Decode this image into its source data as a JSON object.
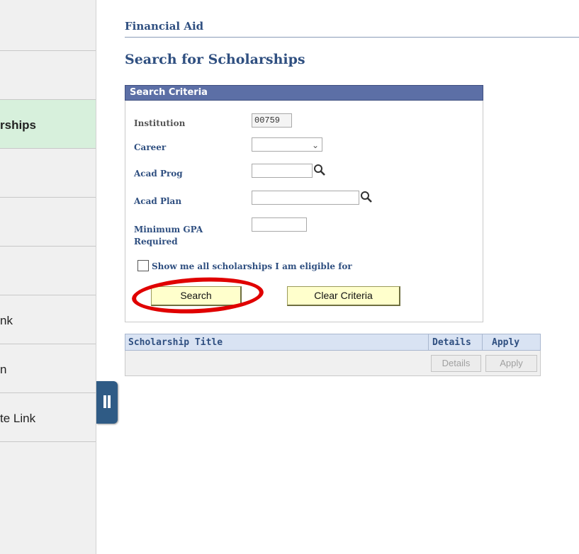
{
  "sidebar": {
    "items": [
      {
        "label": ""
      },
      {
        "label": ""
      },
      {
        "label": "rships"
      },
      {
        "label": ""
      },
      {
        "label": ""
      },
      {
        "label": ""
      },
      {
        "label": "nk"
      },
      {
        "label": "n"
      },
      {
        "label": "te Link"
      }
    ],
    "active_index": 2
  },
  "breadcrumb": "Financial Aid",
  "page_title": "Search for Scholarships",
  "criteria": {
    "header": "Search Criteria",
    "institution_label": "Institution",
    "institution_value": "00759",
    "career_label": "Career",
    "career_value": "",
    "acad_prog_label": "Acad Prog",
    "acad_prog_value": "",
    "acad_plan_label": "Acad Plan",
    "acad_plan_value": "",
    "min_gpa_label_1": "Minimum GPA",
    "min_gpa_label_2": "Required",
    "min_gpa_value": "",
    "show_all_label": "Show me all scholarships I am eligible for",
    "show_all_checked": false
  },
  "buttons": {
    "search": "Search",
    "clear": "Clear Criteria"
  },
  "results": {
    "columns": [
      "Scholarship Title",
      "Details",
      "Apply"
    ],
    "row_details_button": "Details",
    "row_apply_button": "Apply"
  },
  "icons": {
    "lookup": "magnifier-icon",
    "dropdown": "chevron-down-icon",
    "collapse": "pause-icon"
  },
  "colors": {
    "accent": "#2f4f80",
    "header_bar": "#5c6fa6",
    "button_bg": "#ffffcc",
    "active_nav": "#d7f0dc",
    "annotation": "#e00000"
  }
}
